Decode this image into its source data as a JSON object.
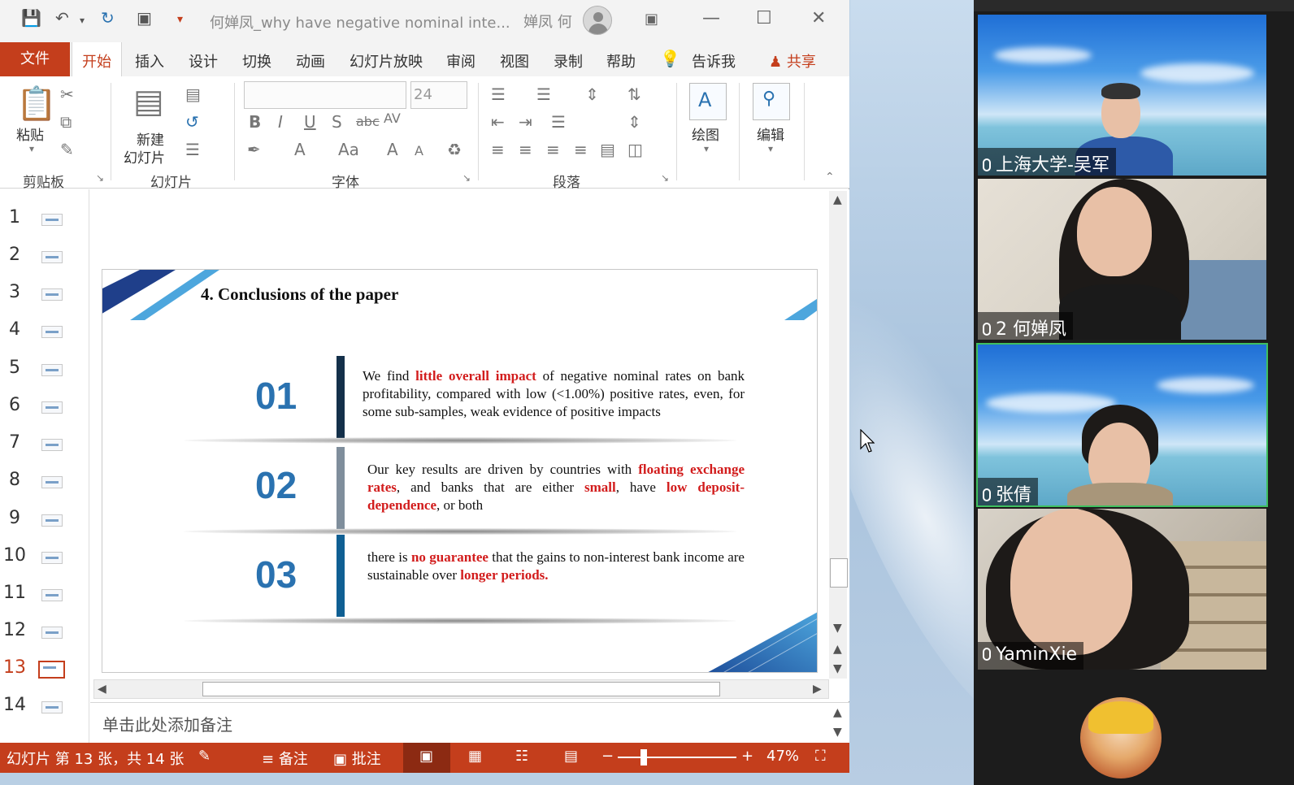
{
  "titlebar": {
    "doc_title": "何婵凤_why have negative nominal inte...",
    "user_name": "婵凤 何"
  },
  "menu": {
    "file": "文件",
    "tabs": [
      "开始",
      "插入",
      "设计",
      "切换",
      "动画",
      "幻灯片放映",
      "审阅",
      "视图",
      "录制",
      "帮助",
      "告诉我"
    ],
    "share": "共享"
  },
  "ribbon": {
    "paste": "粘贴",
    "new_slide": "新建",
    "new_slide2": "幻灯片",
    "font_size": "24",
    "draw": "绘图",
    "edit": "编辑",
    "groups": [
      "剪贴板",
      "幻灯片",
      "字体",
      "段落"
    ]
  },
  "thumbnails": [
    "1",
    "2",
    "3",
    "4",
    "5",
    "6",
    "7",
    "8",
    "9",
    "10",
    "11",
    "12",
    "13",
    "14"
  ],
  "active_slide_index": 13,
  "slide": {
    "title": "4. Conclusions of the paper",
    "items": [
      {
        "num": "01",
        "bar_color": "#14304a",
        "parts": [
          {
            "text": "We find ",
            "hl": false
          },
          {
            "text": "little overall impact",
            "hl": true
          },
          {
            "text": " of negative nominal rates on bank profitability, compared with low (<1.00%) positive rates, even, for some sub-samples, weak evidence of positive impacts",
            "hl": false
          }
        ]
      },
      {
        "num": "02",
        "bar_color": "#7f8e9c",
        "parts": [
          {
            "text": "Our key results are driven by countries with ",
            "hl": false
          },
          {
            "text": "floating exchange rates",
            "hl": true
          },
          {
            "text": ", and banks that are either ",
            "hl": false
          },
          {
            "text": "small",
            "hl": true
          },
          {
            "text": ", have ",
            "hl": false
          },
          {
            "text": "low deposit-dependence",
            "hl": true
          },
          {
            "text": ", or both",
            "hl": false
          }
        ]
      },
      {
        "num": "03",
        "bar_color": "#0f5f93",
        "parts": [
          {
            "text": "there is ",
            "hl": false
          },
          {
            "text": "no guarantee",
            "hl": true
          },
          {
            "text": " that the gains to non-interest bank income are sustainable over ",
            "hl": false
          },
          {
            "text": "longer periods.",
            "hl": true
          }
        ]
      }
    ]
  },
  "notes_placeholder": "单击此处添加备注",
  "status": {
    "slide_info": "幻灯片 第 13 张，共 14 张",
    "notes": "备注",
    "comments": "批注",
    "zoom": "47%"
  },
  "meeting": {
    "participants": [
      "上海大学-吴军",
      "2 何婵凤",
      "张倩",
      "YaminXie"
    ]
  },
  "colors": {
    "accent": "#c43e1c",
    "highlight": "#d21c1c",
    "slide_blue": "#2a72b0",
    "active_border": "#3fbf5f"
  }
}
